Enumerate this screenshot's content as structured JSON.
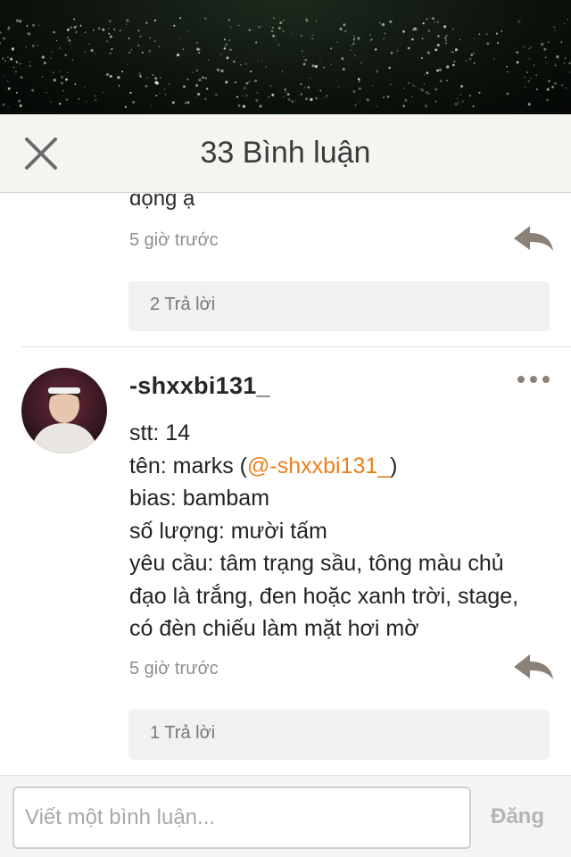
{
  "header": {
    "count": "33",
    "title": "Bình luận"
  },
  "comments": [
    {
      "text_tail": "dọng ạ",
      "time": "5 giờ trước",
      "replies_label": "2 Trả lời"
    },
    {
      "username": "-shxxbi131_",
      "lines": [
        "stt: 14",
        "tên: marks (",
        "@-shxxbi131_",
        ")",
        "bias: bambam",
        "số lượng: mười tấm",
        "yêu cầu: tâm trạng sầu, tông màu chủ",
        "đạo là trắng, đen hoặc xanh trời, stage,",
        "có đèn chiếu làm mặt hơi mờ"
      ],
      "time": "5 giờ trước",
      "replies_label": "1 Trả lời"
    }
  ],
  "footer": {
    "placeholder": "Viết một bình luận...",
    "post_label": "Đăng"
  },
  "colors": {
    "mention": "#e8801d",
    "header_bg": "#f5f4f0",
    "icon_gray": "#8a8178"
  },
  "icons": [
    "close-icon",
    "reply-icon",
    "more-icon"
  ]
}
